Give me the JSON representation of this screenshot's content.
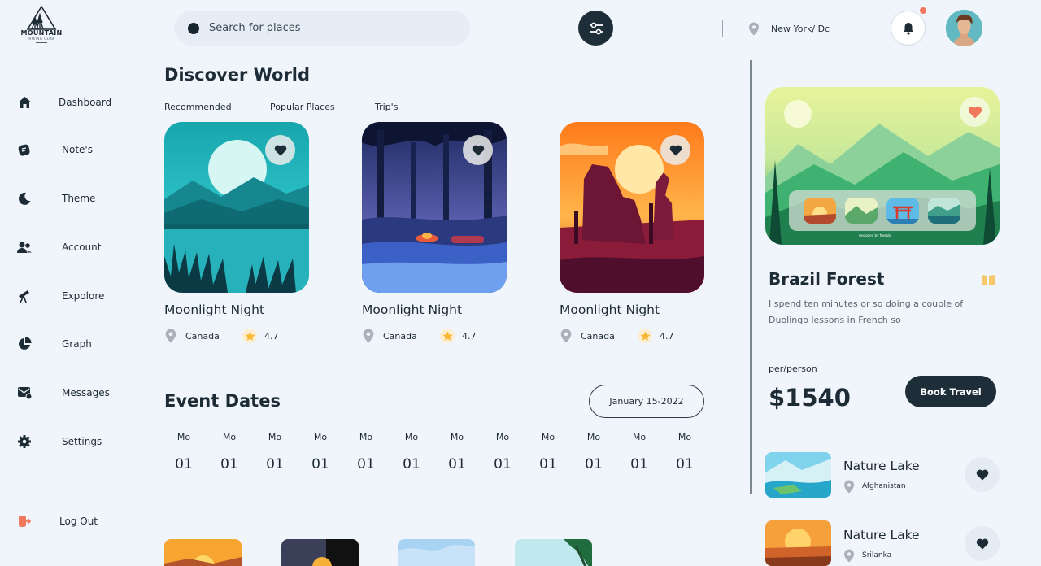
{
  "brand": {
    "line1": "MOUNTAIN",
    "line2": "HIKING CLUB"
  },
  "sidebar": {
    "items": [
      {
        "label": "Dashboard",
        "icon": "home-icon"
      },
      {
        "label": "Note's",
        "icon": "notes-icon"
      },
      {
        "label": "Theme",
        "icon": "moon-icon"
      },
      {
        "label": "Account",
        "icon": "users-icon"
      },
      {
        "label": "Expolore",
        "icon": "telescope-icon"
      },
      {
        "label": "Graph",
        "icon": "pie-chart-icon"
      },
      {
        "label": "Messages",
        "icon": "mail-icon"
      },
      {
        "label": "Settings",
        "icon": "gear-icon"
      }
    ],
    "logout": {
      "label": "Log Out",
      "icon": "logout-icon",
      "color": "#f2785d"
    }
  },
  "header": {
    "search_placeholder": "Search for places",
    "location": "New York/ Dc",
    "accent": "#1e2e38",
    "notification_color": "#f2785d"
  },
  "discover": {
    "title": "Discover World",
    "tabs": [
      "Recommended",
      "Popular Places",
      "Trip's"
    ],
    "cards": [
      {
        "title": "Moonlight Night",
        "location": "Canada",
        "rating": "4.7"
      },
      {
        "title": "Moonlight Night",
        "location": "Canada",
        "rating": "4.7"
      },
      {
        "title": "Moonlight Night",
        "location": "Canada",
        "rating": "4.7"
      }
    ]
  },
  "events": {
    "title": "Event Dates",
    "date_range": "January 15-2022",
    "days": [
      {
        "name": "Mo",
        "date": "01"
      },
      {
        "name": "Mo",
        "date": "01"
      },
      {
        "name": "Mo",
        "date": "01"
      },
      {
        "name": "Mo",
        "date": "01"
      },
      {
        "name": "Mo",
        "date": "01"
      },
      {
        "name": "Mo",
        "date": "01"
      },
      {
        "name": "Mo",
        "date": "01"
      },
      {
        "name": "Mo",
        "date": "01"
      },
      {
        "name": "Mo",
        "date": "01"
      },
      {
        "name": "Mo",
        "date": "01"
      },
      {
        "name": "Mo",
        "date": "01"
      },
      {
        "name": "Mo",
        "date": "01"
      }
    ]
  },
  "detail": {
    "credit": "designed by freepik",
    "title": "Brazil Forest",
    "description": "I spend ten minutes or so doing a couple of Duolingo lessons in French so",
    "per_person_label": "per/person",
    "price": "$1540",
    "book_label": "Book Travel"
  },
  "suggestions": [
    {
      "title": "Nature Lake",
      "location": "Afghanistan"
    },
    {
      "title": "Nature Lake",
      "location": "Srilanka"
    }
  ]
}
